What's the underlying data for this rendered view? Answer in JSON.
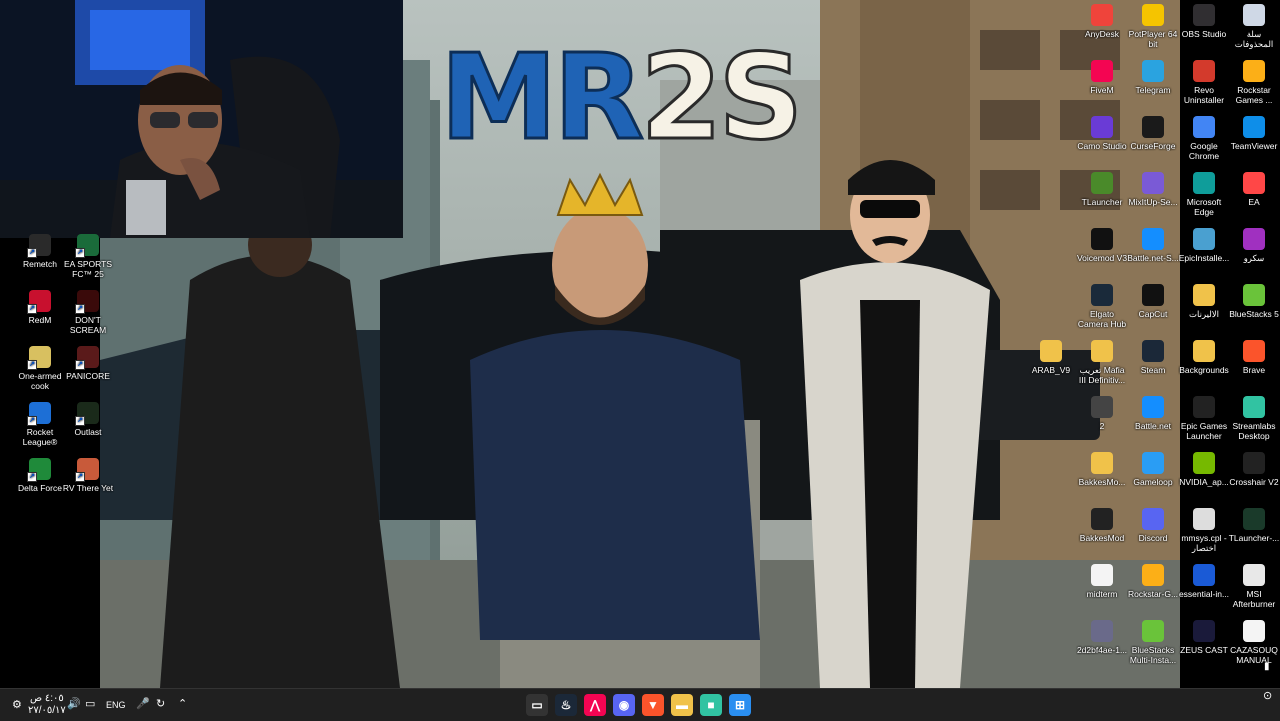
{
  "wallpaper": {
    "logo_part1": "MR",
    "logo_part2": "2S"
  },
  "desktop_icons_left": [
    {
      "label": "Remetch",
      "icon": "remetch-icon",
      "color": "#2a2a2a"
    },
    {
      "label": "EA SPORTS FC™ 25",
      "icon": "ea-fc-icon",
      "color": "#1a6b3a"
    },
    {
      "label": "RedM",
      "icon": "redm-icon",
      "color": "#c8102e"
    },
    {
      "label": "DON'T SCREAM",
      "icon": "dont-scream-icon",
      "color": "#3a0a0a"
    },
    {
      "label": "One-armed cook",
      "icon": "one-armed-cook-icon",
      "color": "#d8c060"
    },
    {
      "label": "PANICORE",
      "icon": "panicore-icon",
      "color": "#5a1a1a"
    },
    {
      "label": "Rocket League®",
      "icon": "rocket-league-icon",
      "color": "#1d6fd6"
    },
    {
      "label": "Outlast",
      "icon": "outlast-icon",
      "color": "#1a2a1a"
    },
    {
      "label": "Delta Force",
      "icon": "delta-force-icon",
      "color": "#1f8a3a"
    },
    {
      "label": "RV There Yet",
      "icon": "rv-there-yet-icon",
      "color": "#c85a3a"
    }
  ],
  "desktop_icons_right": [
    {
      "label": "AnyDesk",
      "icon": "anydesk-icon",
      "color": "#ef443b"
    },
    {
      "label": "PotPlayer 64 bit",
      "icon": "potplayer-icon",
      "color": "#f5c400"
    },
    {
      "label": "OBS Studio",
      "icon": "obs-icon",
      "color": "#302e31"
    },
    {
      "label": "سلة المحذوفات",
      "icon": "recycle-bin-icon",
      "color": "#cfd8e6"
    },
    {
      "label": "FiveM",
      "icon": "fivem-icon",
      "color": "#f40552"
    },
    {
      "label": "Telegram",
      "icon": "telegram-icon",
      "color": "#2aa3e0"
    },
    {
      "label": "Revo Uninstaller",
      "icon": "revo-icon",
      "color": "#d33a2c"
    },
    {
      "label": "Rockstar Games ...",
      "icon": "rockstar-icon",
      "color": "#fcaf17"
    },
    {
      "label": "Camo Studio",
      "icon": "camo-icon",
      "color": "#6a3bd6"
    },
    {
      "label": "CurseForge",
      "icon": "curseforge-icon",
      "color": "#1a1a1a"
    },
    {
      "label": "Google Chrome",
      "icon": "chrome-icon",
      "color": "#4285f4"
    },
    {
      "label": "TeamViewer",
      "icon": "teamviewer-icon",
      "color": "#0e8ee9"
    },
    {
      "label": "TLauncher",
      "icon": "tlauncher-icon",
      "color": "#4a8a2a"
    },
    {
      "label": "MixItUp-Se...",
      "icon": "mixitup-icon",
      "color": "#7a5ad6"
    },
    {
      "label": "Microsoft Edge",
      "icon": "edge-icon",
      "color": "#0f9d9a"
    },
    {
      "label": "EA",
      "icon": "ea-icon",
      "color": "#ff4747"
    },
    {
      "label": "Voicemod V3",
      "icon": "voicemod-icon",
      "color": "#111"
    },
    {
      "label": "Battle.net-S...",
      "icon": "battlenet-setup-icon",
      "color": "#148eff"
    },
    {
      "label": "EpicInstalle...",
      "icon": "epic-installer-icon",
      "color": "#4aa0d0"
    },
    {
      "label": "سكرو",
      "icon": "skro-icon",
      "color": "#a030c0"
    },
    {
      "label": "Elgato Camera Hub",
      "icon": "elgato-icon",
      "color": "#1a2a3a"
    },
    {
      "label": "CapCut",
      "icon": "capcut-icon",
      "color": "#111"
    },
    {
      "label": "الاليرنات",
      "icon": "folder-icon",
      "color": "#f0c24a"
    },
    {
      "label": "BlueStacks 5",
      "icon": "bluestacks-icon",
      "color": "#6ac33a"
    },
    {
      "label": "ARAB_V9",
      "icon": "folder-icon",
      "color": "#f0c24a"
    },
    {
      "label": "تعريب Mafia III Definitiv...",
      "icon": "folder-icon",
      "color": "#f0c24a"
    },
    {
      "label": "Steam",
      "icon": "steam-icon",
      "color": "#1b2838"
    },
    {
      "label": "Backgrounds",
      "icon": "folder-icon",
      "color": "#f0c24a"
    },
    {
      "label": "Brave",
      "icon": "brave-icon",
      "color": "#fb542b"
    },
    {
      "label": "2",
      "icon": "file-icon",
      "color": "#444"
    },
    {
      "label": "Battle.net",
      "icon": "battlenet-icon",
      "color": "#148eff"
    },
    {
      "label": "Epic Games Launcher",
      "icon": "epic-games-icon",
      "color": "#222"
    },
    {
      "label": "Streamlabs Desktop",
      "icon": "streamlabs-icon",
      "color": "#31c3a2"
    },
    {
      "label": "BakkesMo...",
      "icon": "folder-icon",
      "color": "#f0c24a"
    },
    {
      "label": "Gameloop",
      "icon": "gameloop-icon",
      "color": "#2a9df4"
    },
    {
      "label": "NVIDIA_ap...",
      "icon": "nvidia-icon",
      "color": "#76b900"
    },
    {
      "label": "Crosshair V2",
      "icon": "crosshair-icon",
      "color": "#222"
    },
    {
      "label": "BakkesMod",
      "icon": "bakkesmod-icon",
      "color": "#222"
    },
    {
      "label": "Discord",
      "icon": "discord-icon",
      "color": "#5865f2"
    },
    {
      "label": "mmsys.cpl - اختصار",
      "icon": "mmsys-icon",
      "color": "#ddd"
    },
    {
      "label": "TLauncher-...",
      "icon": "tlauncher-alt-icon",
      "color": "#1a3a2a"
    },
    {
      "label": "midterm",
      "icon": "pdf-icon",
      "color": "#f4f4f4"
    },
    {
      "label": "Rockstar-G...",
      "icon": "rockstar-setup-icon",
      "color": "#fcaf17"
    },
    {
      "label": "essential-in...",
      "icon": "essential-icon",
      "color": "#1a5ad6"
    },
    {
      "label": "MSI Afterburner",
      "icon": "msi-icon",
      "color": "#e8e8e8"
    },
    {
      "label": "2d2bf4ae-1...",
      "icon": "file-icon",
      "color": "#6a6a8a"
    },
    {
      "label": "BlueStacks Multi-Insta...",
      "icon": "bluestacks-multi-icon",
      "color": "#6ac33a"
    },
    {
      "label": "ZEUS CAST",
      "icon": "zeus-cast-icon",
      "color": "#1a1a3a"
    },
    {
      "label": "CAZASOUQ MANUAL",
      "icon": "pdf-icon",
      "color": "#f4f4f4"
    }
  ],
  "taskbar": {
    "time": "٤:٠٥ ص",
    "date": "٢٧/٠٥/١٧",
    "language": "ENG",
    "apps": [
      {
        "name": "task-view-icon",
        "color": "#333",
        "glyph": "▭"
      },
      {
        "name": "steam-icon",
        "color": "#1b2838",
        "glyph": "♨"
      },
      {
        "name": "fivem-icon",
        "color": "#f40552",
        "glyph": "⋀"
      },
      {
        "name": "discord-icon",
        "color": "#5865f2",
        "glyph": "◉"
      },
      {
        "name": "brave-icon",
        "color": "#fb542b",
        "glyph": "▼"
      },
      {
        "name": "file-explorer-icon",
        "color": "#f0c24a",
        "glyph": "▬"
      },
      {
        "name": "streamlabs-icon",
        "color": "#31c3a2",
        "glyph": "■"
      },
      {
        "name": "start-icon",
        "color": "#2a8ef0",
        "glyph": "⊞"
      }
    ]
  }
}
